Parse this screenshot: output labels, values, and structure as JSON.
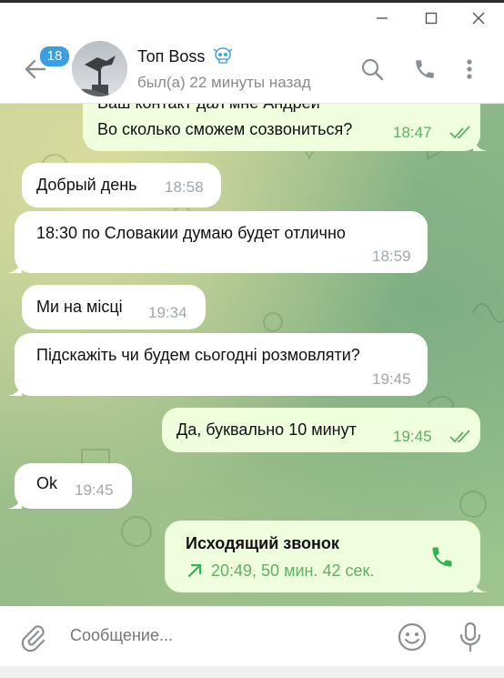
{
  "window_controls": {
    "minimize_icon": "minimize-icon",
    "maximize_icon": "maximize-icon",
    "close_icon": "close-icon"
  },
  "header": {
    "unread_badge": "18",
    "chat_name": "Топ Boss",
    "status": "был(а) 22 минуты назад",
    "name_emoji": "skull-icon"
  },
  "messages": [
    {
      "type": "outgoing",
      "lines": [
        "Ваш контакт дал мне Андрей",
        "Во сколько сможем созвониться?"
      ],
      "time": "18:47",
      "read": true
    },
    {
      "type": "incoming",
      "text": "Добрый день",
      "time": "18:58"
    },
    {
      "type": "incoming",
      "text": "18:30 по Словакии думаю будет отлично",
      "time": "18:59"
    },
    {
      "type": "incoming",
      "text": "Ми на місці",
      "time": "19:34"
    },
    {
      "type": "incoming",
      "text": "Підскажіть чи будем сьогодні розмовляти?",
      "time": "19:45"
    },
    {
      "type": "outgoing",
      "text": "Да, буквально 10 минут",
      "time": "19:45",
      "read": true
    },
    {
      "type": "incoming",
      "text": "Ok",
      "time": "19:45"
    },
    {
      "type": "call",
      "title": "Исходящий звонок",
      "details": "20:49, 50 мин. 42 сек.",
      "direction": "outgoing"
    }
  ],
  "composer": {
    "placeholder": "Сообщение..."
  },
  "colors": {
    "accent": "#3a9ee0",
    "outgoing_bubble": "#efffde",
    "incoming_bubble": "#ffffff",
    "read_ticks": "#5fae63",
    "call_icon": "#2fb454"
  }
}
